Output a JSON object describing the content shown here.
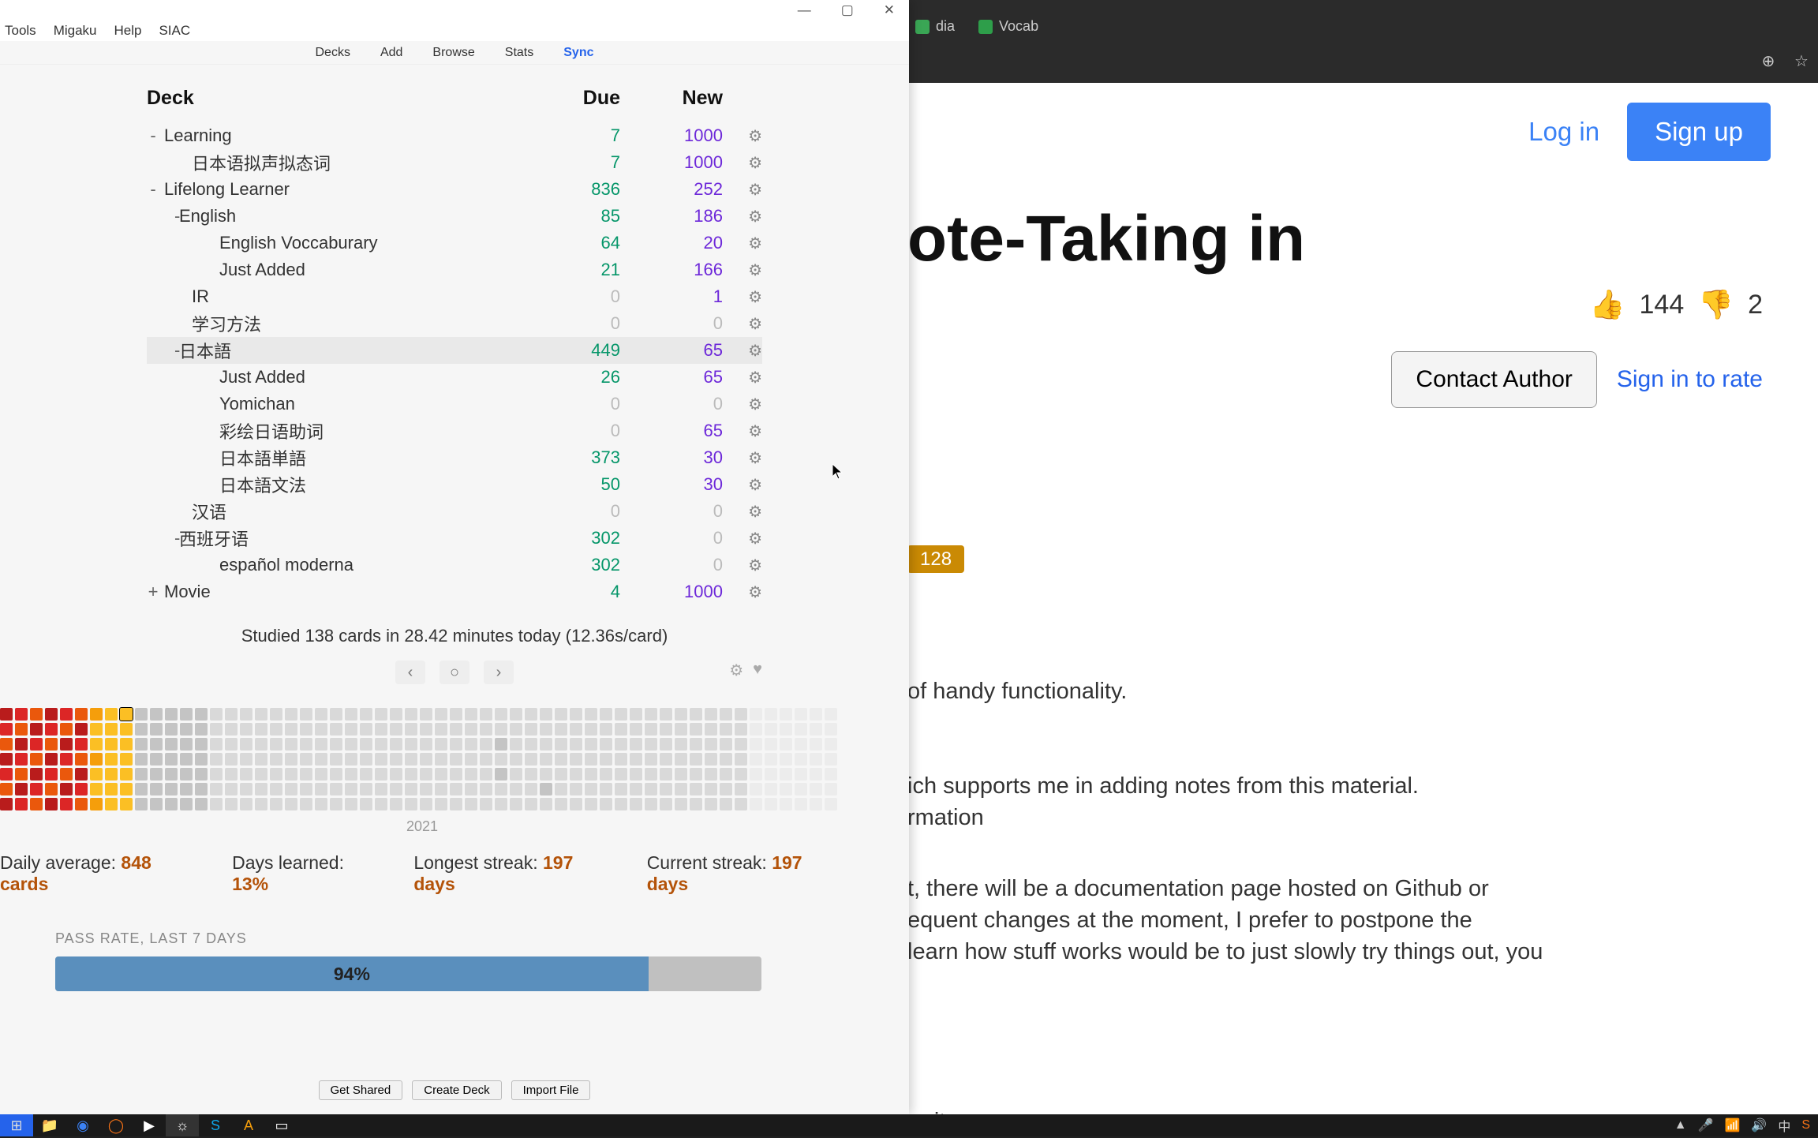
{
  "browser": {
    "tabs": [
      {
        "label": "dia",
        "favicon": "#3aa655"
      },
      {
        "label": "Vocab",
        "favicon": "#2e9e4a"
      }
    ],
    "icons": {
      "zoom": "⊕",
      "star": "☆"
    }
  },
  "web": {
    "login": "Log in",
    "signup": "Sign up",
    "title_partial": "ote-Taking in",
    "likes": "144",
    "dislikes": "2",
    "contact": "Contact Author",
    "signin_rate": "Sign in to rate",
    "badge": "128",
    "p1": "of handy functionality.",
    "p2": "ich supports me in adding notes from this material.",
    "p3": "rmation",
    "p4": "t, there will be a documentation page hosted on Github or",
    "p5": "equent changes at the moment, I prefer to postpone the",
    "p6": "learn how stuff works would be to just slowly try things out, you",
    "p7": "or it"
  },
  "anki": {
    "menus": [
      "Tools",
      "Migaku",
      "Help",
      "SIAC"
    ],
    "toolbar": {
      "decks": "Decks",
      "add": "Add",
      "browse": "Browse",
      "stats": "Stats",
      "sync": "Sync"
    },
    "headers": {
      "deck": "Deck",
      "due": "Due",
      "new": "New"
    },
    "decks": [
      {
        "indent": 0,
        "toggle": "-",
        "name": "Learning",
        "due": "7",
        "new": "1000"
      },
      {
        "indent": 1,
        "toggle": "",
        "name": "日本语拟声拟态词",
        "due": "7",
        "new": "1000"
      },
      {
        "indent": 0,
        "toggle": "-",
        "name": "Lifelong Learner",
        "due": "836",
        "new": "252"
      },
      {
        "indent": 1,
        "toggle": "-",
        "name": "English",
        "due": "85",
        "new": "186"
      },
      {
        "indent": 2,
        "toggle": "",
        "name": "English Voccaburary",
        "due": "64",
        "new": "20"
      },
      {
        "indent": 2,
        "toggle": "",
        "name": "Just Added",
        "due": "21",
        "new": "166"
      },
      {
        "indent": 1,
        "toggle": "",
        "name": "IR",
        "due": "0",
        "new": "1"
      },
      {
        "indent": 1,
        "toggle": "",
        "name": "学习方法",
        "due": "0",
        "new": "0"
      },
      {
        "indent": 1,
        "toggle": "-",
        "name": "日本語",
        "due": "449",
        "new": "65",
        "selected": true
      },
      {
        "indent": 2,
        "toggle": "",
        "name": "Just Added",
        "due": "26",
        "new": "65"
      },
      {
        "indent": 2,
        "toggle": "",
        "name": "Yomichan",
        "due": "0",
        "new": "0"
      },
      {
        "indent": 2,
        "toggle": "",
        "name": "彩绘日语助词",
        "due": "0",
        "new": "65"
      },
      {
        "indent": 2,
        "toggle": "",
        "name": "日本語単語",
        "due": "373",
        "new": "30"
      },
      {
        "indent": 2,
        "toggle": "",
        "name": "日本語文法",
        "due": "50",
        "new": "30"
      },
      {
        "indent": 1,
        "toggle": "",
        "name": "汉语",
        "due": "0",
        "new": "0"
      },
      {
        "indent": 1,
        "toggle": "-",
        "name": "西班牙语",
        "due": "302",
        "new": "0"
      },
      {
        "indent": 2,
        "toggle": "",
        "name": "español moderna",
        "due": "302",
        "new": "0"
      },
      {
        "indent": 0,
        "toggle": "+",
        "name": "Movie",
        "due": "4",
        "new": "1000"
      }
    ],
    "study_line": "Studied 138 cards in 28.42 minutes today (12.36s/card)",
    "year": "2021",
    "stats": {
      "avg_label": "Daily average: ",
      "avg_val": "848 cards",
      "learned_label": "Days learned: ",
      "learned_val": "13%",
      "longest_label": "Longest streak: ",
      "longest_val": "197 days",
      "current_label": "Current streak: ",
      "current_val": "197 days"
    },
    "pass_label": "PASS RATE, LAST 7 DAYS",
    "pass_val": "94%",
    "bottom": {
      "get": "Get Shared",
      "create": "Create Deck",
      "import": "Import File"
    }
  },
  "taskbar": {
    "lang": "中",
    "sys": [
      "▲",
      "🎤",
      "🔈",
      "⚙"
    ]
  },
  "heatmap_palette": [
    "#b91c1c",
    "#dc2626",
    "#ea580c",
    "#f59e0b",
    "#fbbf24",
    "#d9d9d9",
    "#c4c4c4"
  ]
}
